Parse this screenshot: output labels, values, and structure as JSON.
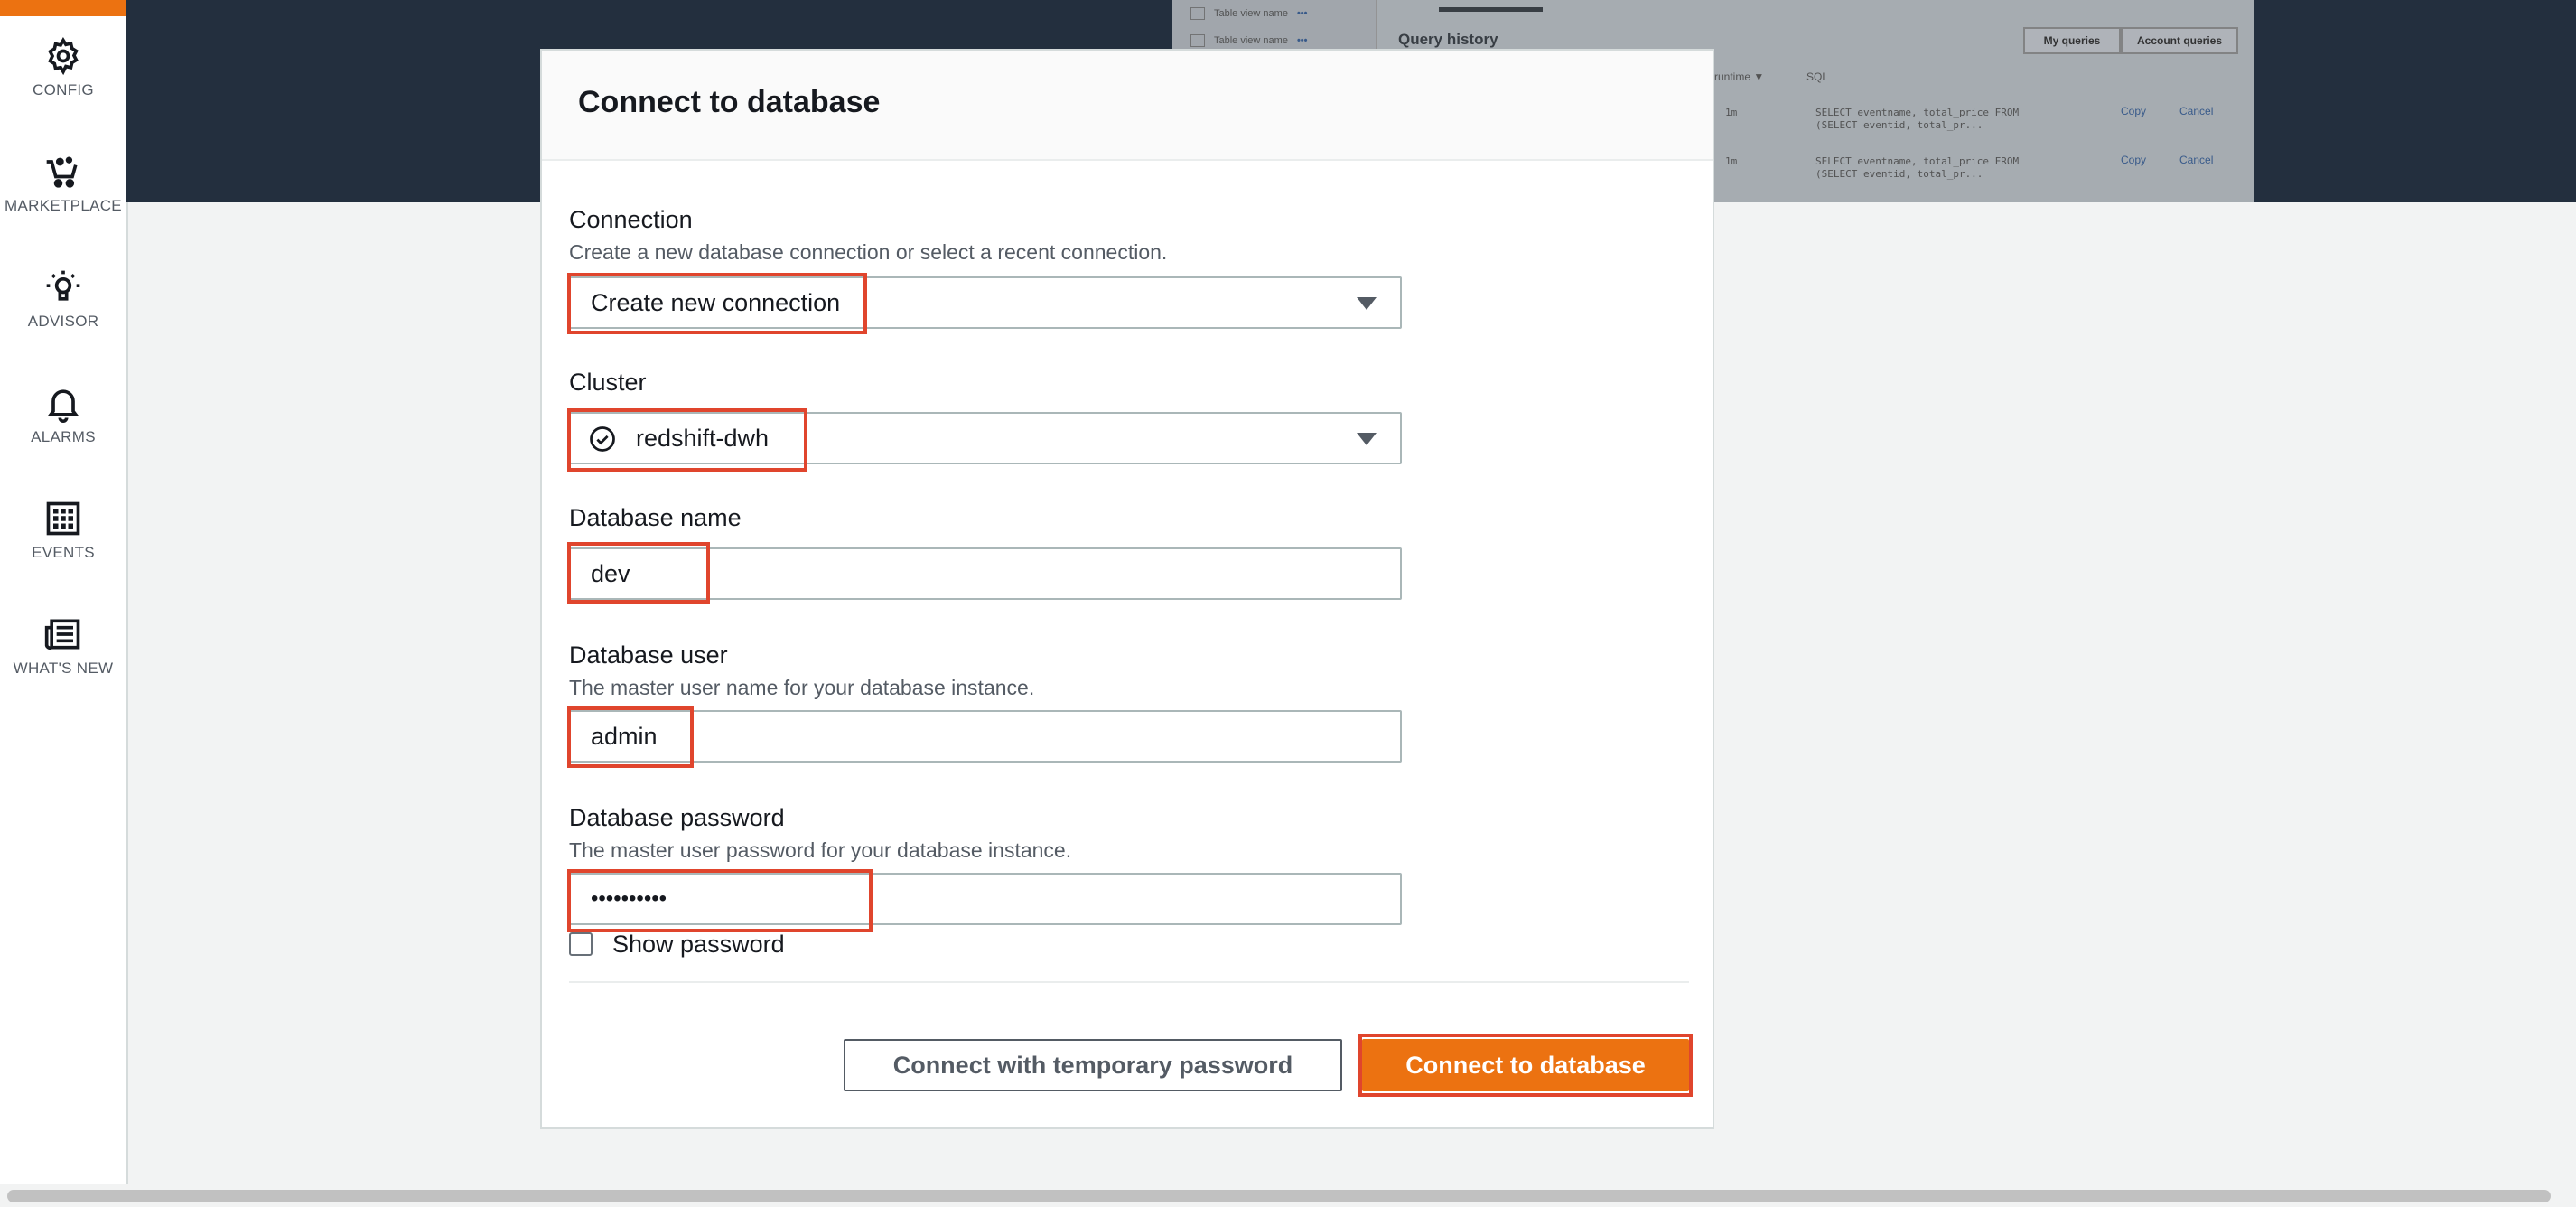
{
  "sidebar": {
    "accent_color": "#ec7211",
    "items": [
      {
        "label": "CONFIG",
        "icon": "gear-icon"
      },
      {
        "label": "MARKETPLACE",
        "icon": "cart-icon"
      },
      {
        "label": "ADVISOR",
        "icon": "lightbulb-icon"
      },
      {
        "label": "ALARMS",
        "icon": "bell-icon"
      },
      {
        "label": "EVENTS",
        "icon": "grid-icon"
      },
      {
        "label": "WHAT'S NEW",
        "icon": "newspaper-icon"
      }
    ]
  },
  "background": {
    "left_rows": [
      "Table view name",
      "Table view name"
    ],
    "title": "Query history",
    "buttons": [
      "My queries",
      "Account queries"
    ],
    "columns": [
      "runtime ▼",
      "SQL"
    ],
    "rows": [
      {
        "runtime": "1m",
        "sql": "SELECT eventname, total_price FROM (SELECT eventid, total_pr...",
        "copy": "Copy",
        "cancel": "Cancel"
      },
      {
        "runtime": "1m",
        "sql": "SELECT eventname, total_price FROM (SELECT eventid, total_pr...",
        "copy": "Copy",
        "cancel": "Cancel"
      }
    ]
  },
  "modal": {
    "title": "Connect to database",
    "connection": {
      "label": "Connection",
      "description": "Create a new database connection or select a recent connection.",
      "value": "Create new connection"
    },
    "cluster": {
      "label": "Cluster",
      "value": "redshift-dwh",
      "status": "available"
    },
    "database_name": {
      "label": "Database name",
      "value": "dev"
    },
    "database_user": {
      "label": "Database user",
      "description": "The master user name for your database instance.",
      "value": "admin"
    },
    "database_password": {
      "label": "Database password",
      "description": "The master user password for your database instance.",
      "value": "••••••••••"
    },
    "show_password": {
      "label": "Show password",
      "checked": false
    },
    "buttons": {
      "secondary": "Connect with temporary password",
      "primary": "Connect to database"
    }
  },
  "colors": {
    "header_band": "#232f3e",
    "primary_button": "#ec7211",
    "highlight": "#e0452d"
  }
}
